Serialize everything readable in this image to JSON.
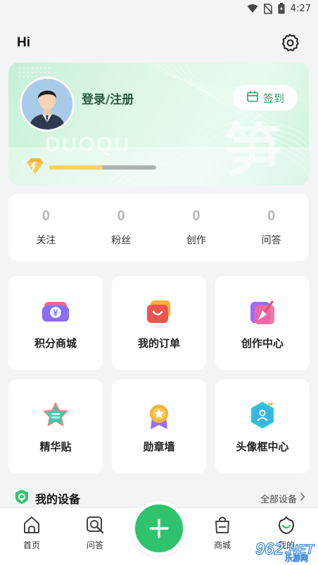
{
  "status_bar": {
    "time": "4:27"
  },
  "header": {
    "greeting": "Hi",
    "settings_icon": "gear-icon"
  },
  "profile": {
    "login_label": "登录/注册",
    "checkin_label": "签到",
    "watermark_en": "DUOQU",
    "watermark_cn": "笋",
    "level_progress": 0.5,
    "colors": {
      "accent": "#2fc36d",
      "card_bg": "#d6f5e2",
      "progress": "#f5cf72"
    }
  },
  "stats": [
    {
      "value": "0",
      "label": "关注"
    },
    {
      "value": "0",
      "label": "粉丝"
    },
    {
      "value": "0",
      "label": "创作"
    },
    {
      "value": "0",
      "label": "问答"
    }
  ],
  "tiles": [
    {
      "label": "积分商城",
      "icon": "points-mall-icon"
    },
    {
      "label": "我的订单",
      "icon": "shopping-bag-icon"
    },
    {
      "label": "创作中心",
      "icon": "pen-icon"
    },
    {
      "label": "精华贴",
      "icon": "star-post-icon"
    },
    {
      "label": "勋章墙",
      "icon": "medal-icon"
    },
    {
      "label": "头像框中心",
      "icon": "avatar-frame-icon"
    }
  ],
  "devices": {
    "title": "我的设备",
    "all_label": "全部设备"
  },
  "bottom_nav": [
    {
      "label": "首页",
      "icon": "home-icon"
    },
    {
      "label": "问答",
      "icon": "qa-search-icon"
    },
    {
      "label": "商城",
      "icon": "mall-bag-icon"
    },
    {
      "label": "我的",
      "icon": "profile-leaf-icon"
    }
  ],
  "fab_icon": "plus-icon",
  "site_watermark": {
    "number": "962",
    "suffix": ".NET",
    "text": "乐游网"
  }
}
